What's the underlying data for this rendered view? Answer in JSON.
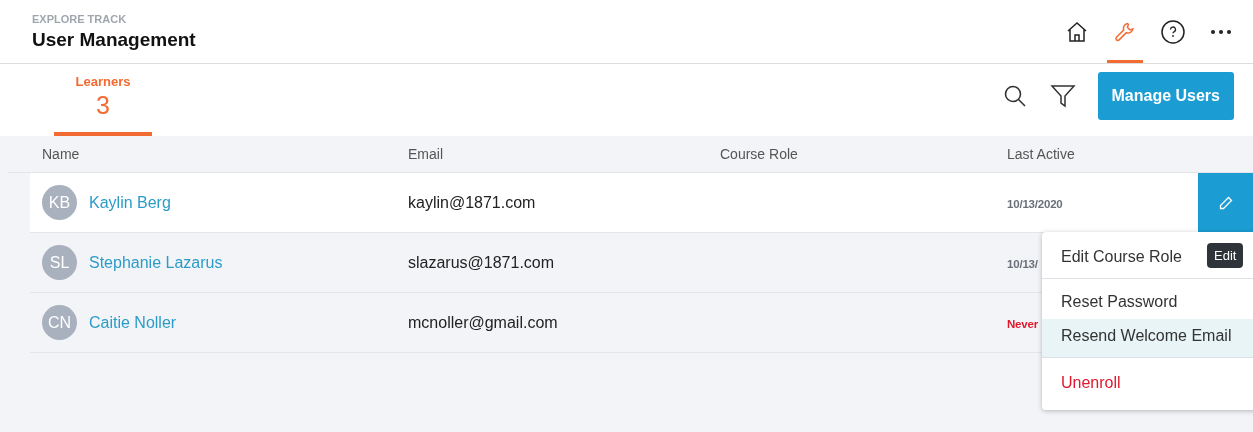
{
  "header": {
    "eyebrow": "EXPLORE TRACK",
    "title": "User Management"
  },
  "nav": [
    {
      "kind": "home",
      "selected": false
    },
    {
      "kind": "wrench",
      "selected": true
    },
    {
      "kind": "help",
      "selected": false
    },
    {
      "kind": "more",
      "selected": false
    }
  ],
  "tabs": [
    {
      "label": "Learners",
      "count": "3",
      "selected": true
    }
  ],
  "toolbar": {
    "button": "Manage Users"
  },
  "table": {
    "columns": [
      "Name",
      "Email",
      "Course Role",
      "Last Active"
    ],
    "rows": [
      {
        "initials": "KB",
        "name": "Kaylin Berg",
        "email": "kaylin@1871.com",
        "last_active": {
          "text": "10/13/2020",
          "kind": "date"
        },
        "selected": true
      },
      {
        "initials": "SL",
        "name": "Stephanie Lazarus",
        "email": "slazarus@1871.com",
        "last_active": {
          "text": "10/13/",
          "kind": "date"
        },
        "selected": false
      },
      {
        "initials": "CN",
        "name": "Caitie Noller",
        "email": "mcnoller@gmail.com",
        "last_active": {
          "text": "Never",
          "kind": "never"
        },
        "selected": false
      }
    ]
  },
  "tooltip": "Edit",
  "menu": [
    {
      "label": "Edit Course Role",
      "kind": "normal",
      "selected": false,
      "divider_after": true
    },
    {
      "label": "Reset Password",
      "kind": "normal",
      "selected": false,
      "divider_after": false
    },
    {
      "label": "Resend Welcome Email",
      "kind": "normal",
      "selected": true,
      "divider_after": true
    },
    {
      "label": "Unenroll",
      "kind": "danger",
      "selected": false,
      "divider_after": false
    }
  ]
}
